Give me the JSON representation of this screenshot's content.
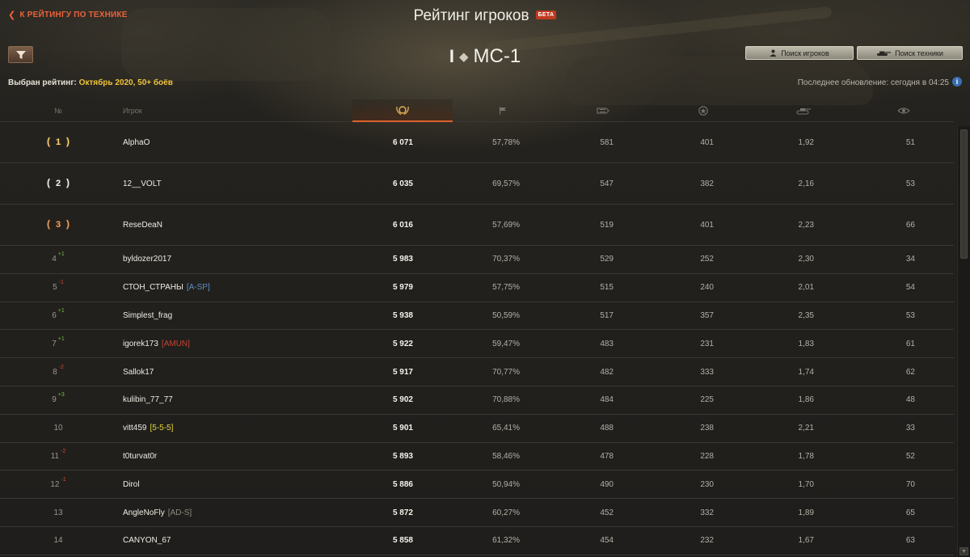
{
  "header": {
    "back_label": "К рейтингу по технике",
    "title": "Рейтинг игроков",
    "beta_badge": "БЕТА",
    "vehicle_tier": "I",
    "vehicle_name": "МС-1",
    "search_players_label": "Поиск игроков",
    "search_tech_label": "Поиск техники",
    "selected_rating_label": "Выбран рейтинг:",
    "selected_rating_value": "Октябрь 2020, 50+ боёв",
    "last_update": "Последнее обновление: сегодня в 04:25",
    "info_icon": "i"
  },
  "columns": {
    "rank": "№",
    "player": "Игрок",
    "icons": [
      "rating-laurel-icon",
      "flag-icon",
      "damage-icon",
      "star-experience-icon",
      "tank-frags-icon",
      "spotting-icon"
    ]
  },
  "accent_color": "#d9632d",
  "rows": [
    {
      "rank": "1",
      "medal": "gold",
      "delta": "",
      "delta_dir": "",
      "name": "AlphaO",
      "clan": "",
      "clan_color": "",
      "rating": "6 071",
      "winrate": "57,78%",
      "damage": "581",
      "exp": "401",
      "frags": "1,92",
      "spot": "51"
    },
    {
      "rank": "2",
      "medal": "silver",
      "delta": "",
      "delta_dir": "",
      "name": "12__VOLT",
      "clan": "",
      "clan_color": "",
      "rating": "6 035",
      "winrate": "69,57%",
      "damage": "547",
      "exp": "382",
      "frags": "2,16",
      "spot": "53"
    },
    {
      "rank": "3",
      "medal": "bronze",
      "delta": "",
      "delta_dir": "",
      "name": "ReseDeaN",
      "clan": "",
      "clan_color": "",
      "rating": "6 016",
      "winrate": "57,69%",
      "damage": "519",
      "exp": "401",
      "frags": "2,23",
      "spot": "66"
    },
    {
      "rank": "4",
      "medal": "",
      "delta": "+1",
      "delta_dir": "up",
      "name": "byldozer2017",
      "clan": "",
      "clan_color": "",
      "rating": "5 983",
      "winrate": "70,37%",
      "damage": "529",
      "exp": "252",
      "frags": "2,30",
      "spot": "34"
    },
    {
      "rank": "5",
      "medal": "",
      "delta": "-1",
      "delta_dir": "down",
      "name": "СТОН_СТРАНЫ",
      "clan": "[A-SP]",
      "clan_color": "blue",
      "rating": "5 979",
      "winrate": "57,75%",
      "damage": "515",
      "exp": "240",
      "frags": "2,01",
      "spot": "54"
    },
    {
      "rank": "6",
      "medal": "",
      "delta": "+1",
      "delta_dir": "up",
      "name": "Simplest_frag",
      "clan": "",
      "clan_color": "",
      "rating": "5 938",
      "winrate": "50,59%",
      "damage": "517",
      "exp": "357",
      "frags": "2,35",
      "spot": "53"
    },
    {
      "rank": "7",
      "medal": "",
      "delta": "+1",
      "delta_dir": "up",
      "name": "igorek173",
      "clan": "[AMUN]",
      "clan_color": "red",
      "rating": "5 922",
      "winrate": "59,47%",
      "damage": "483",
      "exp": "231",
      "frags": "1,83",
      "spot": "61"
    },
    {
      "rank": "8",
      "medal": "",
      "delta": "-2",
      "delta_dir": "down",
      "name": "Sallok17",
      "clan": "",
      "clan_color": "",
      "rating": "5 917",
      "winrate": "70,77%",
      "damage": "482",
      "exp": "333",
      "frags": "1,74",
      "spot": "62"
    },
    {
      "rank": "9",
      "medal": "",
      "delta": "+3",
      "delta_dir": "up",
      "name": "kulibin_77_77",
      "clan": "",
      "clan_color": "",
      "rating": "5 902",
      "winrate": "70,88%",
      "damage": "484",
      "exp": "225",
      "frags": "1,86",
      "spot": "48"
    },
    {
      "rank": "10",
      "medal": "",
      "delta": "",
      "delta_dir": "",
      "name": "vitt459",
      "clan": "[5-5-5]",
      "clan_color": "yellow",
      "rating": "5 901",
      "winrate": "65,41%",
      "damage": "488",
      "exp": "238",
      "frags": "2,21",
      "spot": "33"
    },
    {
      "rank": "11",
      "medal": "",
      "delta": "-2",
      "delta_dir": "down",
      "name": "t0turvat0r",
      "clan": "",
      "clan_color": "",
      "rating": "5 893",
      "winrate": "58,46%",
      "damage": "478",
      "exp": "228",
      "frags": "1,78",
      "spot": "52"
    },
    {
      "rank": "12",
      "medal": "",
      "delta": "-1",
      "delta_dir": "down",
      "name": "Dirol",
      "clan": "",
      "clan_color": "",
      "rating": "5 886",
      "winrate": "50,94%",
      "damage": "490",
      "exp": "230",
      "frags": "1,70",
      "spot": "70"
    },
    {
      "rank": "13",
      "medal": "",
      "delta": "",
      "delta_dir": "",
      "name": "AngleNoFly",
      "clan": "[AD-S]",
      "clan_color": "gray",
      "rating": "5 872",
      "winrate": "60,27%",
      "damage": "452",
      "exp": "332",
      "frags": "1,89",
      "spot": "65"
    },
    {
      "rank": "14",
      "medal": "",
      "delta": "",
      "delta_dir": "",
      "name": "CANYON_67",
      "clan": "",
      "clan_color": "",
      "rating": "5 858",
      "winrate": "61,32%",
      "damage": "454",
      "exp": "232",
      "frags": "1,67",
      "spot": "63"
    }
  ]
}
